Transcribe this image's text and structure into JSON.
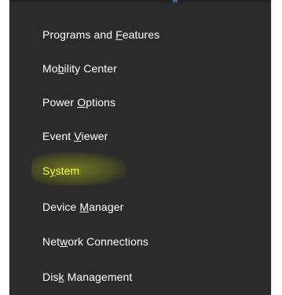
{
  "menu": {
    "items": [
      {
        "pre": "Programs and ",
        "key": "F",
        "post": "eatures"
      },
      {
        "pre": "Mo",
        "key": "b",
        "post": "ility Center"
      },
      {
        "pre": "Power ",
        "key": "O",
        "post": "ptions"
      },
      {
        "pre": "Event ",
        "key": "V",
        "post": "iewer"
      },
      {
        "pre": "S",
        "key": "y",
        "post": "stem"
      },
      {
        "pre": "Device ",
        "key": "M",
        "post": "anager"
      },
      {
        "pre": "Net",
        "key": "w",
        "post": "ork Connections"
      },
      {
        "pre": "Dis",
        "key": "k",
        "post": " Management"
      }
    ],
    "selected_index": 4
  },
  "colors": {
    "menu_background": "#2b2b2b",
    "text": "#ffffff",
    "highlight_text": "#f4ff3a",
    "highlight_marker": "#aab419"
  }
}
